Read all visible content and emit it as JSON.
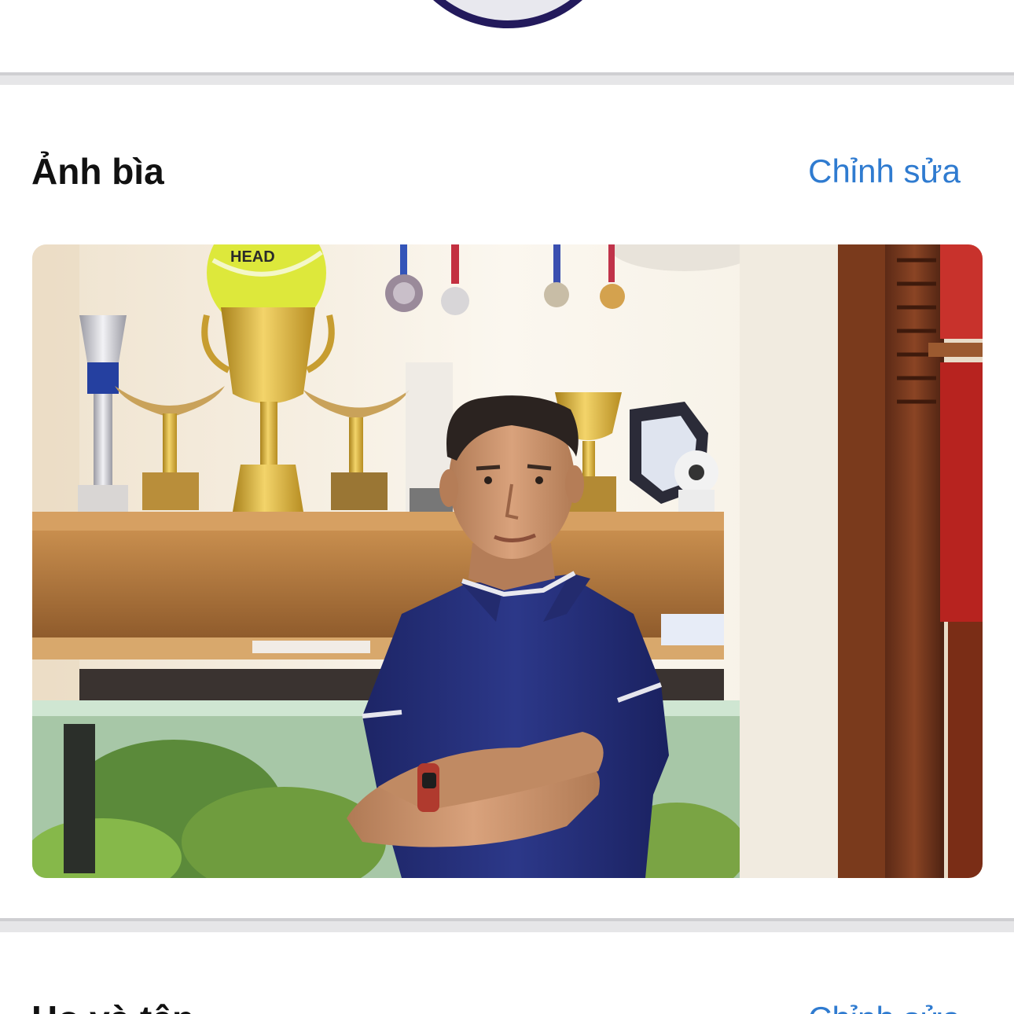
{
  "cover_section": {
    "title": "Ảnh bìa",
    "edit_label": "Chỉnh sửa"
  },
  "name_section": {
    "title": "Họ và tên",
    "edit_label": "Chỉnh sửa"
  },
  "cover_photo": {
    "ball_brand": "HEAD"
  },
  "colors": {
    "accent_link": "#2f7bd0",
    "avatar_border": "#231a5c",
    "divider": "#e6e6e8"
  }
}
